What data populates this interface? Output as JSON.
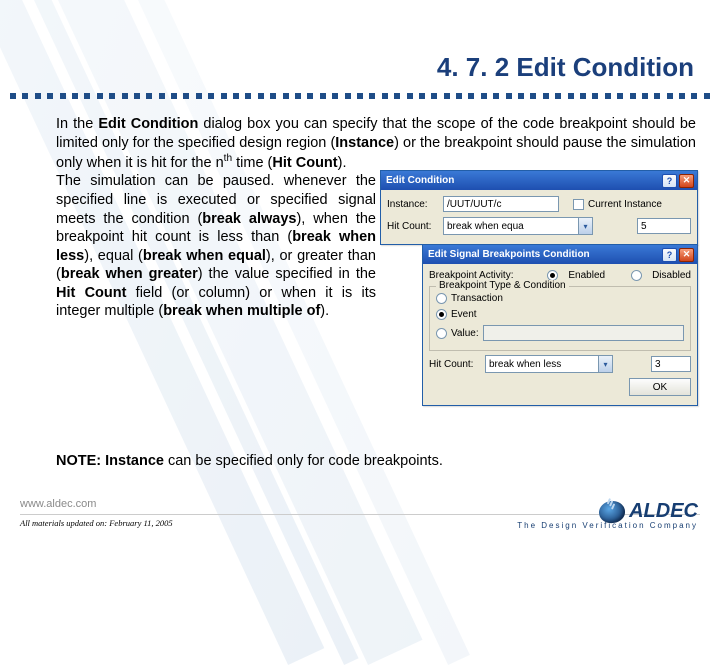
{
  "title": "4. 7. 2 Edit Condition",
  "para_intro_pre": "In the ",
  "para_intro_b1": "Edit Condition",
  "para_intro_mid1": " dialog box you can specify that the scope of the code breakpoint should be limited only for the specified design region (",
  "para_intro_b2": "Instance",
  "para_intro_mid2": ") or the breakpoint should pause the simulation only when it is hit for the n",
  "para_intro_sup": "th",
  "para_intro_mid3": " time (",
  "para_intro_b3": "Hit Count",
  "para_intro_mid4": ").",
  "para_col_pre": "The simulation can be paused. whenever the specified line is executed or specified signal meets the condition (",
  "para_col_b1": "break always",
  "para_col_mid1": "), when the breakpoint hit count is less than (",
  "para_col_b2": "break when less",
  "para_col_mid2": "), equal (",
  "para_col_b3": "break when equal",
  "para_col_mid3": "), or greater than (",
  "para_col_b4": "break when greater",
  "para_col_mid4": ") the value specified in the ",
  "para_col_b5": "Hit Count",
  "para_col_mid5": " field (or column) or when it is its integer multiple (",
  "para_col_b6": "break when multiple of",
  "para_col_mid6": ").",
  "note_b1": "NOTE: Instance",
  "note_rest": " can be specified only for code breakpoints.",
  "footer_url": "www.aldec.com",
  "footer_updated": "All materials updated on: February 11, 2005",
  "footer_brand": "ALDEC",
  "footer_tagline": "The Design Verification Company",
  "dlg1": {
    "title": "Edit Condition",
    "instance_label": "Instance:",
    "instance_value": "/UUT/UUT/c",
    "cur_inst_label": "Current Instance",
    "hitcount_label": "Hit Count:",
    "hitcount_combo": "break when equa",
    "hitcount_value": "5"
  },
  "dlg2": {
    "title": "Edit Signal Breakpoints Condition",
    "activity_label": "Breakpoint Activity:",
    "enabled": "Enabled",
    "disabled": "Disabled",
    "group_title": "Breakpoint Type & Condition",
    "opt_transaction": "Transaction",
    "opt_event": "Event",
    "opt_value": "Value:",
    "hitcount_label": "Hit Count:",
    "hitcount_combo": "break when less",
    "hitcount_value": "3",
    "ok": "OK"
  }
}
